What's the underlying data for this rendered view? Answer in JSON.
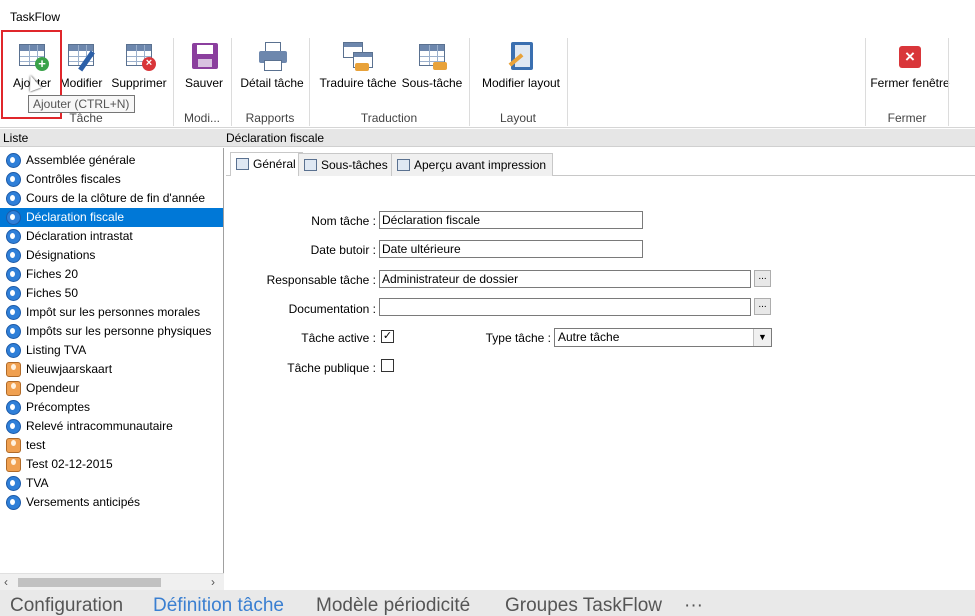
{
  "window": {
    "title": "TaskFlow"
  },
  "ribbon": {
    "buttons": {
      "add": "Ajouter",
      "modify": "Modifier",
      "delete": "Supprimer",
      "save": "Sauver",
      "detail": "Détail tâche",
      "translate": "Traduire tâche",
      "subtask": "Sous-tâche",
      "layout": "Modifier layout",
      "close": "Fermer fenêtre"
    },
    "groups": {
      "task": "Tâche",
      "modi": "Modi...",
      "reports": "Rapports",
      "translation": "Traduction",
      "layout": "Layout",
      "close": "Fermer"
    },
    "tooltip": "Ajouter (CTRL+N)"
  },
  "list": {
    "header": "Liste",
    "items": [
      {
        "label": "Assemblée générale",
        "icon": "globe-icon"
      },
      {
        "label": "Contrôles fiscales",
        "icon": "globe-icon"
      },
      {
        "label": "Cours de la clôture de fin d'année",
        "icon": "globe-icon"
      },
      {
        "label": "Déclaration fiscale",
        "icon": "globe-icon",
        "selected": true
      },
      {
        "label": "Déclaration intrastat",
        "icon": "globe-icon"
      },
      {
        "label": "Désignations",
        "icon": "globe-icon"
      },
      {
        "label": "Fiches 20",
        "icon": "globe-icon"
      },
      {
        "label": "Fiches 50",
        "icon": "globe-icon"
      },
      {
        "label": "Impôt sur les personnes morales",
        "icon": "globe-icon"
      },
      {
        "label": "Impôts sur les personne physiques",
        "icon": "globe-icon"
      },
      {
        "label": "Listing TVA",
        "icon": "globe-icon"
      },
      {
        "label": "Nieuwjaarskaart",
        "icon": "person-icon"
      },
      {
        "label": "Opendeur",
        "icon": "person-icon"
      },
      {
        "label": "Précomptes",
        "icon": "globe-icon"
      },
      {
        "label": "Relevé intracommunautaire",
        "icon": "globe-icon"
      },
      {
        "label": "test",
        "icon": "person-icon"
      },
      {
        "label": "Test 02-12-2015",
        "icon": "person-icon"
      },
      {
        "label": "TVA",
        "icon": "globe-icon"
      },
      {
        "label": "Versements anticipés",
        "icon": "globe-icon"
      }
    ]
  },
  "detail": {
    "header": "Déclaration fiscale",
    "tabs": [
      "Général",
      "Sous-tâches",
      "Aperçu avant impression"
    ],
    "form": {
      "name_label": "Nom tâche :",
      "name_value": "Déclaration fiscale",
      "due_label": "Date butoir :",
      "due_value": "Date ultérieure",
      "owner_label": "Responsable tâche :",
      "owner_value": "Administrateur de dossier",
      "doc_label": "Documentation :",
      "doc_value": "",
      "active_label": "Tâche active :",
      "active_checked": "✓",
      "type_label": "Type tâche :",
      "type_value": "Autre tâche",
      "public_label": "Tâche publique :",
      "ellipsis": "..."
    }
  },
  "bottom_tabs": {
    "config": "Configuration",
    "definition": "Définition tâche",
    "model": "Modèle périodicité",
    "groups": "Groupes TaskFlow",
    "more": "···"
  },
  "colors": {
    "selection": "#0078d7",
    "active_tab": "#3a7fd1",
    "close": "#d9363a"
  }
}
